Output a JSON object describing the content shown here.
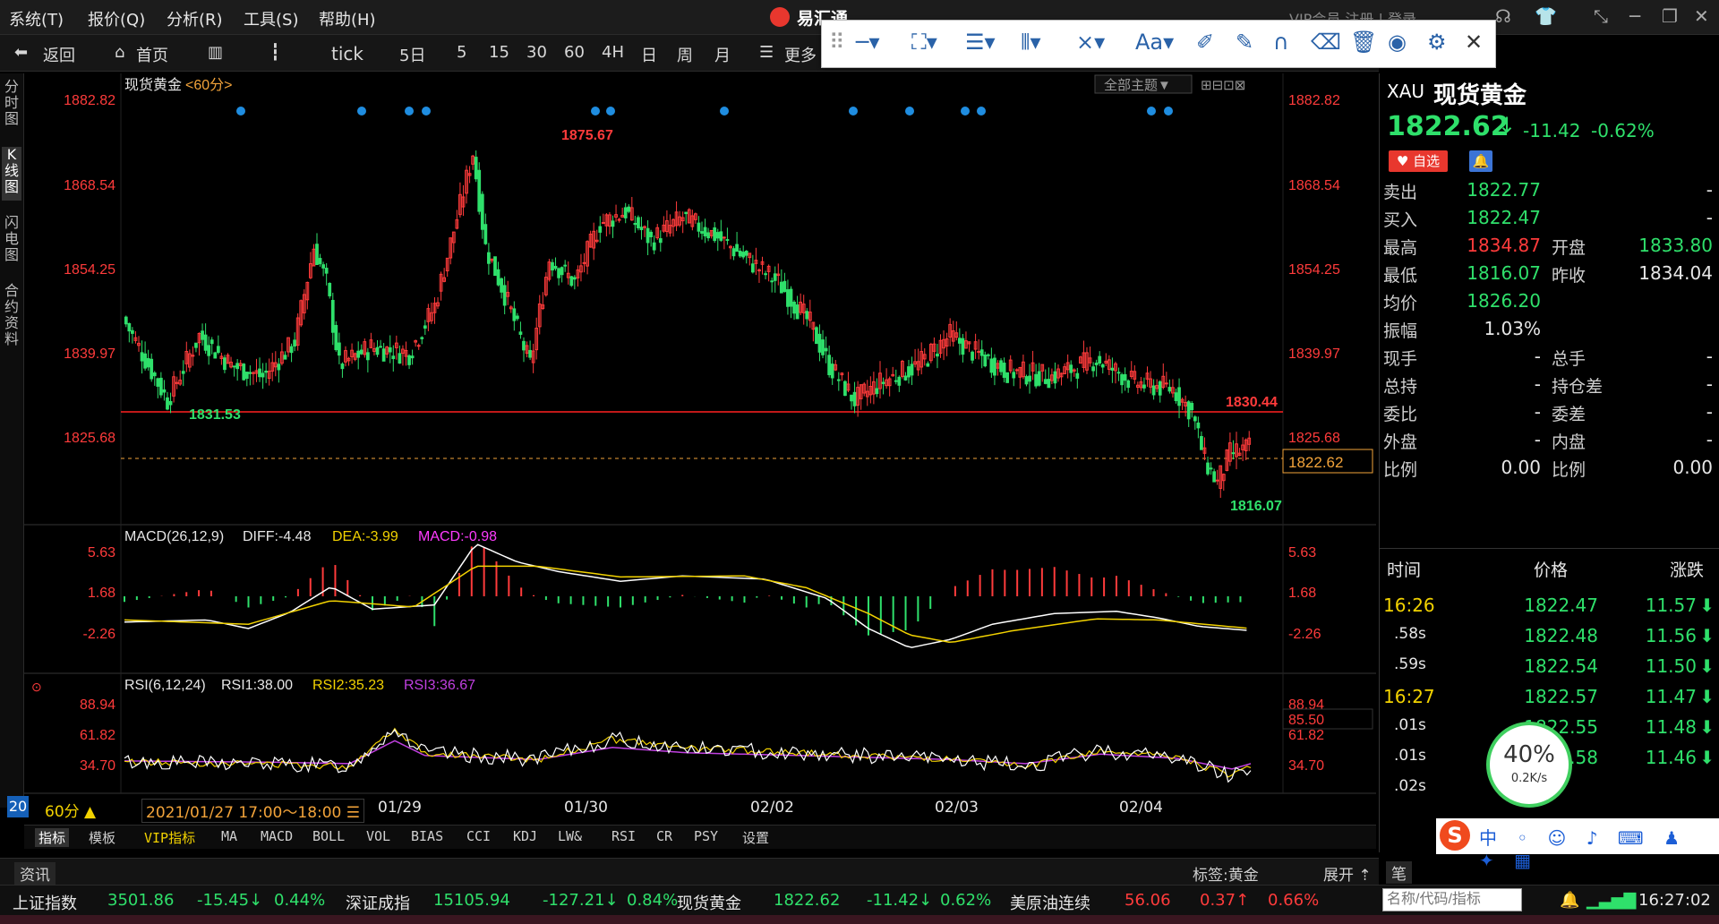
{
  "menubar": {
    "items": [
      "系统(T)",
      "报价(Q)",
      "分析(R)",
      "工具(S)",
      "帮助(H)"
    ],
    "app_title": "易汇通",
    "user_text": "VIP会员  注册  |  登录"
  },
  "toolbar": {
    "back": "返回",
    "home": "首页",
    "tick": "tick",
    "periods": [
      "5日",
      "5",
      "15",
      "30",
      "60",
      "4H",
      "日",
      "周",
      "月"
    ],
    "more": "更多"
  },
  "left_tabs": [
    "分时图",
    "K线图",
    "闪电图",
    "合约资料"
  ],
  "chart": {
    "symbol_label": "现货黄金",
    "period_label": "<60分>",
    "theme_button": "全部主题▼",
    "price_axis": [
      "1882.82",
      "1868.54",
      "1854.25",
      "1839.97",
      "1825.68"
    ],
    "high_label": "1875.67",
    "low_label_left": "1831.53",
    "low_label_right": "1816.07",
    "hline_label": "1830.44",
    "current_label": "1822.62",
    "macd": {
      "title": "MACD(26,12,9)",
      "diff": "DIFF:-4.48",
      "dea": "DEA:-3.99",
      "macd": "MACD:-0.98",
      "axis": [
        "5.63",
        "1.68",
        "-2.26"
      ]
    },
    "rsi": {
      "title": "RSI(6,12,24)",
      "rsi1": "RSI1:38.00",
      "rsi2": "RSI2:35.23",
      "rsi3": "RSI3:36.67",
      "axis": [
        "88.94",
        "61.82",
        "34.70"
      ],
      "right_box": "85.50"
    },
    "time_axis": {
      "badge": "20",
      "period": "60分",
      "range": "2021/01/27 17:00～18:00",
      "dates": [
        "01/29",
        "01/30",
        "02/02",
        "02/03",
        "02/04"
      ]
    },
    "colors": {
      "up": "#ff3b3b",
      "down": "#2fe06b",
      "dea": "#f2d200",
      "rsi3": "#c040e0",
      "hline": "#ff2020"
    }
  },
  "bottom_tabs": [
    "指标",
    "模板",
    "VIP指标",
    "MA",
    "MACD",
    "BOLL",
    "VOL",
    "BIAS",
    "CCI",
    "KDJ",
    "LW&",
    "RSI",
    "CR",
    "PSY",
    "设置"
  ],
  "news_bar": {
    "left": "资讯",
    "tag": "标签:黄金",
    "expand": "展开 ⇡",
    "right": "笔"
  },
  "quote": {
    "code": "XAU",
    "name": "现货黄金",
    "price": "1822.62",
    "arrow": "↓",
    "change": "-11.42",
    "change_pct": "-0.62%",
    "fav_button": "自选",
    "rows": [
      {
        "l1": "卖出",
        "v1": "1822.77",
        "l2": "",
        "v2": "-"
      },
      {
        "l1": "买入",
        "v1": "1822.47",
        "l2": "",
        "v2": "-"
      },
      {
        "l1": "最高",
        "v1": "1834.87",
        "l2": "开盘",
        "v2": "1833.80"
      },
      {
        "l1": "最低",
        "v1": "1816.07",
        "l2": "昨收",
        "v2": "1834.04"
      },
      {
        "l1": "均价",
        "v1": "1826.20",
        "l2": "",
        "v2": ""
      },
      {
        "l1": "振幅",
        "v1": "1.03%",
        "l2": "",
        "v2": ""
      },
      {
        "l1": "现手",
        "v1": "-",
        "l2": "总手",
        "v2": "-"
      },
      {
        "l1": "总持",
        "v1": "-",
        "l2": "持仓差",
        "v2": "-"
      },
      {
        "l1": "委比",
        "v1": "-",
        "l2": "委差",
        "v2": "-"
      },
      {
        "l1": "外盘",
        "v1": "-",
        "l2": "内盘",
        "v2": "-"
      },
      {
        "l1": "比例",
        "v1": "0.00",
        "l2": "比例",
        "v2": "0.00"
      }
    ],
    "ticks_header": [
      "时间",
      "价格",
      "涨跌"
    ],
    "ticks": [
      {
        "time": "16:26",
        "price": "1822.47",
        "chg": "11.57"
      },
      {
        "time": ".58s",
        "price": "1822.48",
        "chg": "11.56"
      },
      {
        "time": ".59s",
        "price": "1822.54",
        "chg": "11.50"
      },
      {
        "time": "16:27",
        "price": "1822.57",
        "chg": "11.47"
      },
      {
        "time": ".01s",
        "price": "1822.55",
        "chg": "11.48"
      },
      {
        "time": ".01s",
        "price": "1822.58",
        "chg": "11.46"
      },
      {
        "time": ".02s",
        "price": "",
        "chg": ""
      }
    ],
    "speed_pct": "40%",
    "speed_rate": "0.2K/s"
  },
  "statusbar": {
    "items": [
      {
        "name": "上证指数",
        "price": "3501.86",
        "chg": "-15.45↓",
        "pct": "0.44%"
      },
      {
        "name": "深证成指",
        "price": "15105.94",
        "chg": "-127.21↓",
        "pct": "0.84%"
      },
      {
        "name": "现货黄金",
        "price": "1822.62",
        "chg": "-11.42↓",
        "pct": "0.62%"
      },
      {
        "name": "美原油连续",
        "price": "56.06",
        "chg": "0.37↑",
        "pct": "0.66%"
      }
    ],
    "search_placeholder": "名称/代码/指标",
    "clock": "16:27:02"
  }
}
